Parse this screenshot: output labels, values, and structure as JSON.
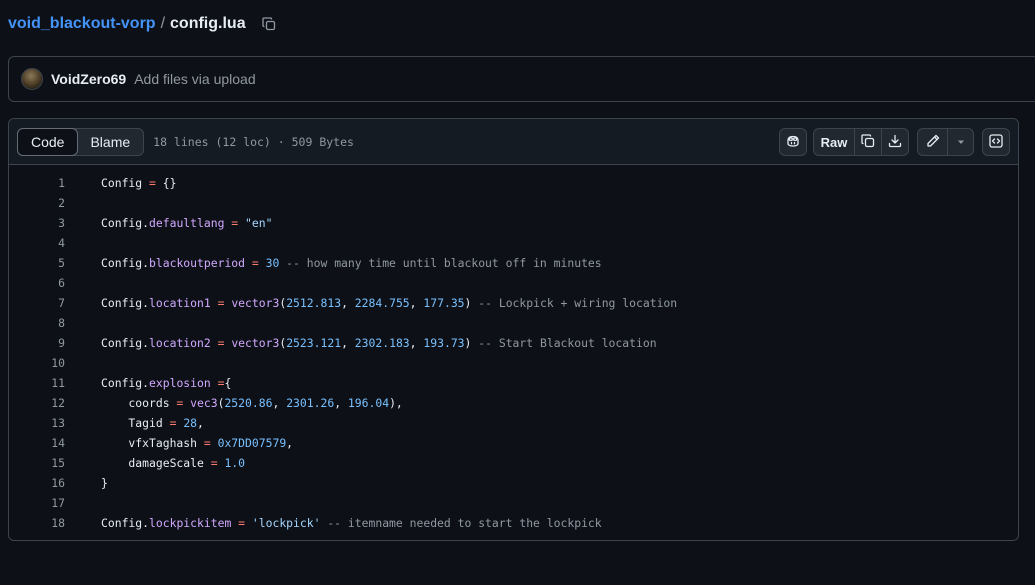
{
  "breadcrumb": {
    "repo": "void_blackout-vorp",
    "separator": "/",
    "file": "config.lua"
  },
  "commit": {
    "author": "VoidZero69",
    "message": "Add files via upload"
  },
  "file_header": {
    "tabs": [
      {
        "label": "Code",
        "active": true
      },
      {
        "label": "Blame",
        "active": false
      }
    ],
    "meta": "18 lines (12 loc) · 509 Bytes",
    "raw_label": "Raw"
  },
  "icons": {
    "copy_path": "copy-icon",
    "copilot": "copilot-icon",
    "copy_raw": "copy-icon",
    "download": "download-icon",
    "edit": "pencil-icon",
    "more": "triangle-down-icon",
    "symbols": "code-square-icon"
  },
  "colors": {
    "link": "#4493f8",
    "background": "#0d1117",
    "header_bg": "#151b23",
    "border": "#3d444d",
    "keyword": "#ff7b72",
    "property": "#d2a8ff",
    "number": "#79c0ff",
    "string": "#a5d6ff",
    "comment": "#9198a1"
  },
  "code_lines": [
    {
      "n": "1",
      "tokens": [
        [
          "",
          "Config"
        ],
        [
          "op",
          " = "
        ],
        [
          "",
          "{}"
        ]
      ]
    },
    {
      "n": "2",
      "tokens": []
    },
    {
      "n": "3",
      "tokens": [
        [
          "",
          "Config."
        ],
        [
          "prop",
          "defaultlang"
        ],
        [
          "op",
          " = "
        ],
        [
          "str",
          "\"en\""
        ]
      ]
    },
    {
      "n": "4",
      "tokens": []
    },
    {
      "n": "5",
      "tokens": [
        [
          "",
          "Config."
        ],
        [
          "prop",
          "blackoutperiod"
        ],
        [
          "op",
          " = "
        ],
        [
          "num",
          "30"
        ],
        [
          "com",
          " -- how many time until blackout off in minutes"
        ]
      ]
    },
    {
      "n": "6",
      "tokens": []
    },
    {
      "n": "7",
      "tokens": [
        [
          "",
          "Config."
        ],
        [
          "prop",
          "location1"
        ],
        [
          "op",
          " = "
        ],
        [
          "func",
          "vector3"
        ],
        [
          "",
          "("
        ],
        [
          "num",
          "2512.813"
        ],
        [
          "",
          ", "
        ],
        [
          "num",
          "2284.755"
        ],
        [
          "",
          ", "
        ],
        [
          "num",
          "177.35"
        ],
        [
          "",
          ")"
        ],
        [
          "com",
          " -- Lockpick + wiring location"
        ]
      ]
    },
    {
      "n": "8",
      "tokens": []
    },
    {
      "n": "9",
      "tokens": [
        [
          "",
          "Config."
        ],
        [
          "prop",
          "location2"
        ],
        [
          "op",
          " = "
        ],
        [
          "func",
          "vector3"
        ],
        [
          "",
          "("
        ],
        [
          "num",
          "2523.121"
        ],
        [
          "",
          ", "
        ],
        [
          "num",
          "2302.183"
        ],
        [
          "",
          ", "
        ],
        [
          "num",
          "193.73"
        ],
        [
          "",
          ")"
        ],
        [
          "com",
          " -- Start Blackout location"
        ]
      ]
    },
    {
      "n": "10",
      "tokens": []
    },
    {
      "n": "11",
      "tokens": [
        [
          "",
          "Config."
        ],
        [
          "prop",
          "explosion"
        ],
        [
          "op",
          " ="
        ],
        [
          "",
          "{"
        ]
      ]
    },
    {
      "n": "12",
      "tokens": [
        [
          "",
          "    coords"
        ],
        [
          "op",
          " = "
        ],
        [
          "func",
          "vec3"
        ],
        [
          "",
          "("
        ],
        [
          "num",
          "2520.86"
        ],
        [
          "",
          ", "
        ],
        [
          "num",
          "2301.26"
        ],
        [
          "",
          ", "
        ],
        [
          "num",
          "196.04"
        ],
        [
          "",
          "),"
        ]
      ]
    },
    {
      "n": "13",
      "tokens": [
        [
          "",
          "    Tagid"
        ],
        [
          "op",
          " = "
        ],
        [
          "num",
          "28"
        ],
        [
          "",
          ","
        ]
      ]
    },
    {
      "n": "14",
      "tokens": [
        [
          "",
          "    vfxTaghash"
        ],
        [
          "op",
          " = "
        ],
        [
          "num",
          "0x7DD07579"
        ],
        [
          "",
          ","
        ]
      ]
    },
    {
      "n": "15",
      "tokens": [
        [
          "",
          "    damageScale"
        ],
        [
          "op",
          " = "
        ],
        [
          "num",
          "1.0"
        ]
      ]
    },
    {
      "n": "16",
      "tokens": [
        [
          "",
          "}"
        ]
      ]
    },
    {
      "n": "17",
      "tokens": []
    },
    {
      "n": "18",
      "tokens": [
        [
          "",
          "Config."
        ],
        [
          "prop",
          "lockpickitem"
        ],
        [
          "op",
          " = "
        ],
        [
          "str",
          "'lockpick'"
        ],
        [
          "com",
          " -- itemname needed to start the lockpick"
        ]
      ]
    }
  ]
}
